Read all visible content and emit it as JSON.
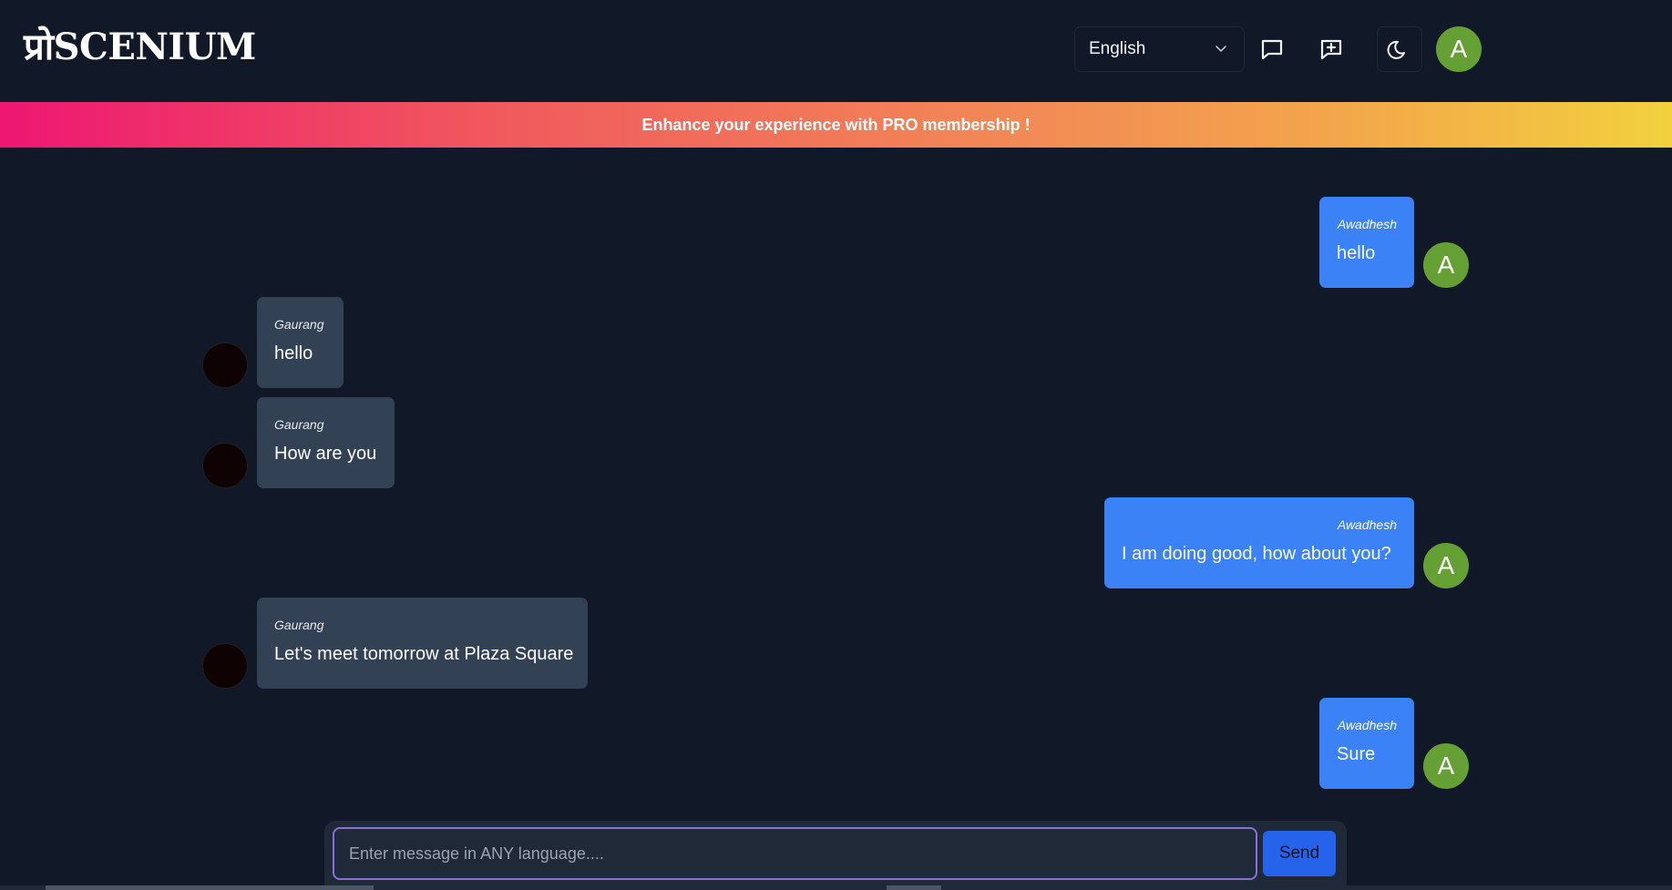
{
  "header": {
    "logo_text": "प्रोSCENIUM",
    "language": {
      "selected": "English"
    },
    "user_avatar_initial": "A"
  },
  "banner": {
    "text": "Enhance your experience with PRO membership !"
  },
  "messages": [
    {
      "side": "sent",
      "sender": "Awadhesh",
      "text": "hello",
      "avatar": "A"
    },
    {
      "side": "received",
      "sender": "Gaurang",
      "text": "hello"
    },
    {
      "side": "received",
      "sender": "Gaurang",
      "text": "How are you"
    },
    {
      "side": "sent",
      "sender": "Awadhesh",
      "text": "I am doing good, how about you?",
      "avatar": "A"
    },
    {
      "side": "received",
      "sender": "Gaurang",
      "text": "Let's meet tomorrow at Plaza Square"
    },
    {
      "side": "sent",
      "sender": "Awadhesh",
      "text": "Sure",
      "avatar": "A"
    }
  ],
  "composer": {
    "placeholder": "Enter message in ANY language....",
    "value": "",
    "send_label": "Send"
  },
  "colors": {
    "background": "#111827",
    "sent_bubble": "#3b82f6",
    "received_bubble": "#334155",
    "avatar": "#65a035",
    "send_button": "#2563eb",
    "input_border": "#8b6fd9"
  },
  "icons": [
    "chat-icon",
    "new-chat-icon",
    "moon-icon",
    "chevron-down-icon"
  ]
}
